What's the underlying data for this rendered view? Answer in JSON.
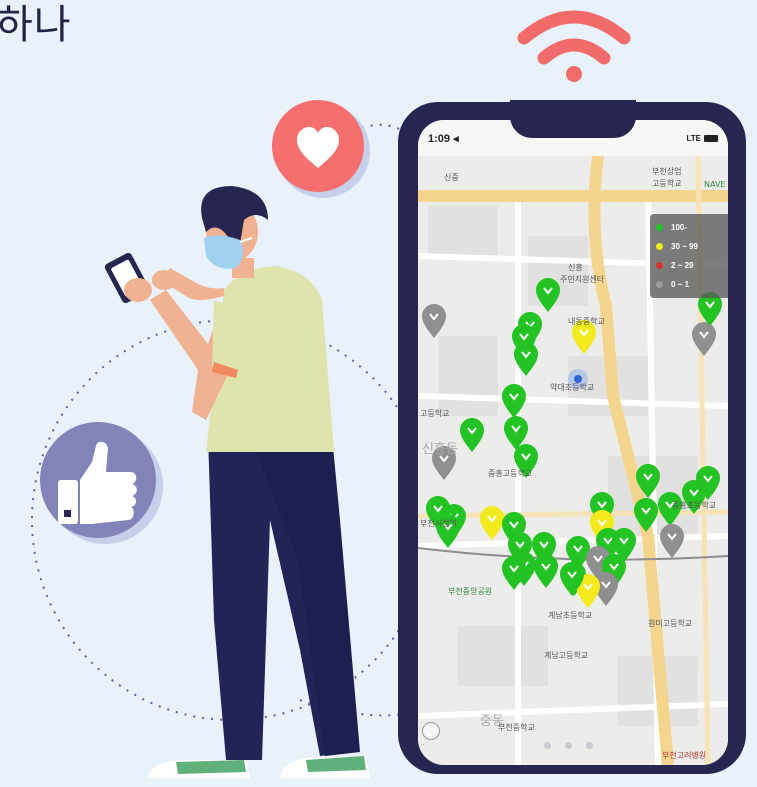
{
  "headline": "하나",
  "phone": {
    "status_time": "1:09 ◂",
    "status_signal": "LTE"
  },
  "map_labels": [
    {
      "text": "신중",
      "cls": ""
    },
    {
      "text": "부천상업",
      "cls": ""
    },
    {
      "text": "고등학교",
      "cls": ""
    },
    {
      "text": "NAVE",
      "cls": "green"
    },
    {
      "text": "신흥",
      "cls": ""
    },
    {
      "text": "주민지원센터",
      "cls": ""
    },
    {
      "text": "내동중학교",
      "cls": ""
    },
    {
      "text": "약대초등학교",
      "cls": ""
    },
    {
      "text": "고등학교",
      "cls": ""
    },
    {
      "text": "신흥동",
      "cls": "big"
    },
    {
      "text": "중흥고등학교",
      "cls": ""
    },
    {
      "text": "부천시청역",
      "cls": ""
    },
    {
      "text": "중흥초등학교",
      "cls": ""
    },
    {
      "text": "부천중앙공원",
      "cls": "green"
    },
    {
      "text": "계남초등학교",
      "cls": ""
    },
    {
      "text": "원미고등학교",
      "cls": ""
    },
    {
      "text": "계남고등학교",
      "cls": ""
    },
    {
      "text": "중동",
      "cls": "big"
    },
    {
      "text": "부천중학교",
      "cls": ""
    },
    {
      "text": "부천고려병원",
      "cls": "red"
    }
  ],
  "legend": [
    {
      "label": "100-",
      "color": "#22c322"
    },
    {
      "label": "30 ~ 99",
      "color": "#f2ea1c"
    },
    {
      "label": "2 ~ 29",
      "color": "#d2342c"
    },
    {
      "label": "0 ~ 1",
      "color": "#9a9a9a"
    }
  ],
  "icons": {
    "wifi": "wifi-icon",
    "heart": "heart-icon",
    "thumb": "thumbs-up-icon"
  },
  "colors": {
    "background": "#e9f1fb",
    "phone_frame": "#262651",
    "wifi": "#f26b6b",
    "heart_bg": "#f56f6f",
    "thumb_bg": "#8283b8",
    "pin_green": "#22c322",
    "pin_yellow": "#f2ea1c",
    "pin_gray": "#8f8f8f"
  }
}
